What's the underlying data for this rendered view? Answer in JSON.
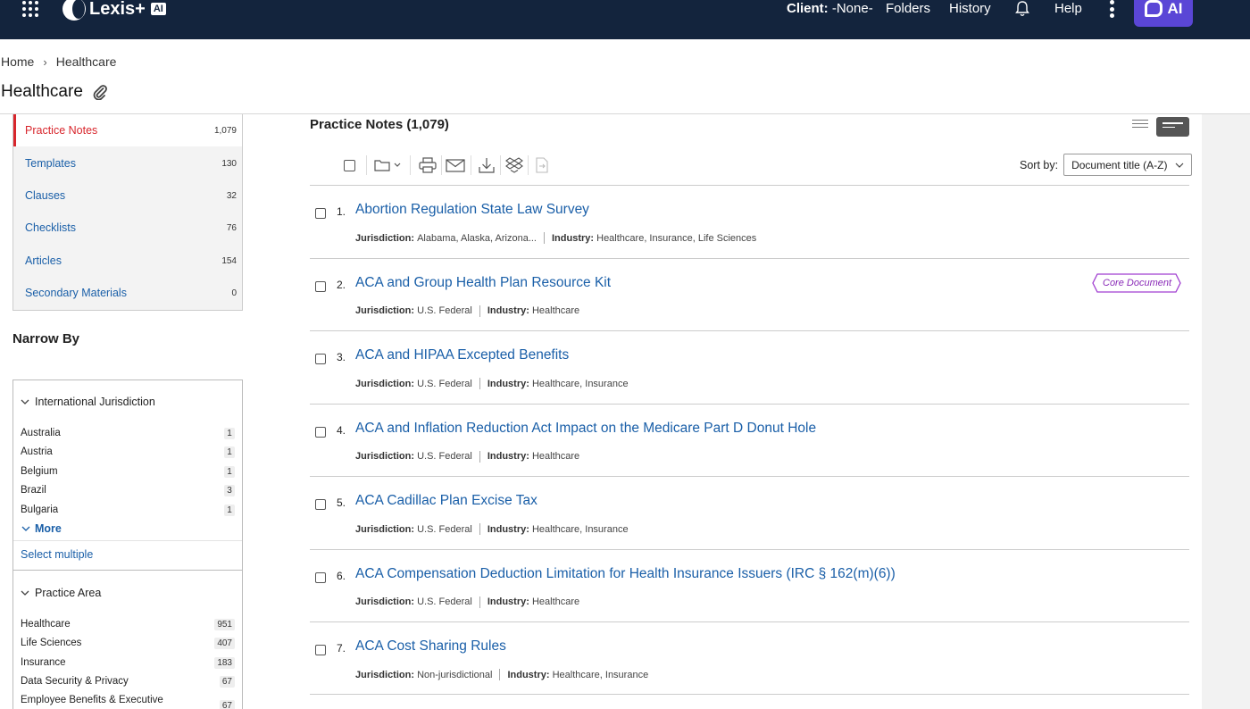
{
  "nav": {
    "brand": "Lexis+",
    "brand_suffix": "AI",
    "client_label": "Client:",
    "client_value": "-None-",
    "folders": "Folders",
    "history": "History",
    "help": "Help",
    "ai_button": "AI"
  },
  "breadcrumb": {
    "home": "Home",
    "separator": "›",
    "current": "Healthcare"
  },
  "page": {
    "title": "Healthcare"
  },
  "content_types": [
    {
      "label": "Practice Notes",
      "count": "1,079",
      "active": true
    },
    {
      "label": "Templates",
      "count": "130"
    },
    {
      "label": "Clauses",
      "count": "32"
    },
    {
      "label": "Checklists",
      "count": "76"
    },
    {
      "label": "Articles",
      "count": "154"
    },
    {
      "label": "Secondary Materials",
      "count": "0"
    }
  ],
  "narrow_by": {
    "heading": "Narrow By",
    "international_jurisdiction": {
      "heading": "International Jurisdiction",
      "items": [
        {
          "label": "Australia",
          "count": "1"
        },
        {
          "label": "Austria",
          "count": "1"
        },
        {
          "label": "Belgium",
          "count": "1"
        },
        {
          "label": "Brazil",
          "count": "3"
        },
        {
          "label": "Bulgaria",
          "count": "1"
        }
      ],
      "more": "More",
      "select_multiple": "Select multiple"
    },
    "practice_area": {
      "heading": "Practice Area",
      "items": [
        {
          "label": "Healthcare",
          "count": "951"
        },
        {
          "label": "Life Sciences",
          "count": "407"
        },
        {
          "label": "Insurance",
          "count": "183"
        },
        {
          "label": "Data Security & Privacy",
          "count": "67"
        },
        {
          "label": "Employee Benefits & Executive",
          "count": "67"
        }
      ]
    }
  },
  "results": {
    "title": "Practice Notes (1,079)",
    "sort_label": "Sort by:",
    "sort_value": "Document title (A-Z)",
    "jurisdiction_label": "Jurisdiction:",
    "industry_label": "Industry:",
    "badge": "Core Document",
    "items": [
      {
        "num": "1.",
        "title": "Abortion Regulation State Law Survey",
        "jurisdiction": "Alabama, Alaska, Arizona...",
        "industry": "Healthcare, Insurance, Life Sciences"
      },
      {
        "num": "2.",
        "title": "ACA and Group Health Plan Resource Kit",
        "jurisdiction": "U.S. Federal",
        "industry": "Healthcare"
      },
      {
        "num": "3.",
        "title": "ACA and HIPAA Excepted Benefits",
        "jurisdiction": "U.S. Federal",
        "industry": "Healthcare, Insurance"
      },
      {
        "num": "4.",
        "title": "ACA and Inflation Reduction Act Impact on the Medicare Part D Donut Hole",
        "jurisdiction": "U.S. Federal",
        "industry": "Healthcare"
      },
      {
        "num": "5.",
        "title": "ACA Cadillac Plan Excise Tax",
        "jurisdiction": "U.S. Federal",
        "industry": "Healthcare, Insurance"
      },
      {
        "num": "6.",
        "title": "ACA Compensation Deduction Limitation for Health Insurance Issuers (IRC § 162(m)(6))",
        "jurisdiction": "U.S. Federal",
        "industry": "Healthcare"
      },
      {
        "num": "7.",
        "title": "ACA Cost Sharing Rules",
        "jurisdiction": "Non-jurisdictional",
        "industry": "Healthcare, Insurance"
      }
    ]
  },
  "colors": {
    "nav_bg": "#13243d",
    "link": "#1a5fa8",
    "active_red": "#d8262c",
    "ai_purple": "#5a46d6",
    "badge_purple": "#8a2bb8"
  }
}
